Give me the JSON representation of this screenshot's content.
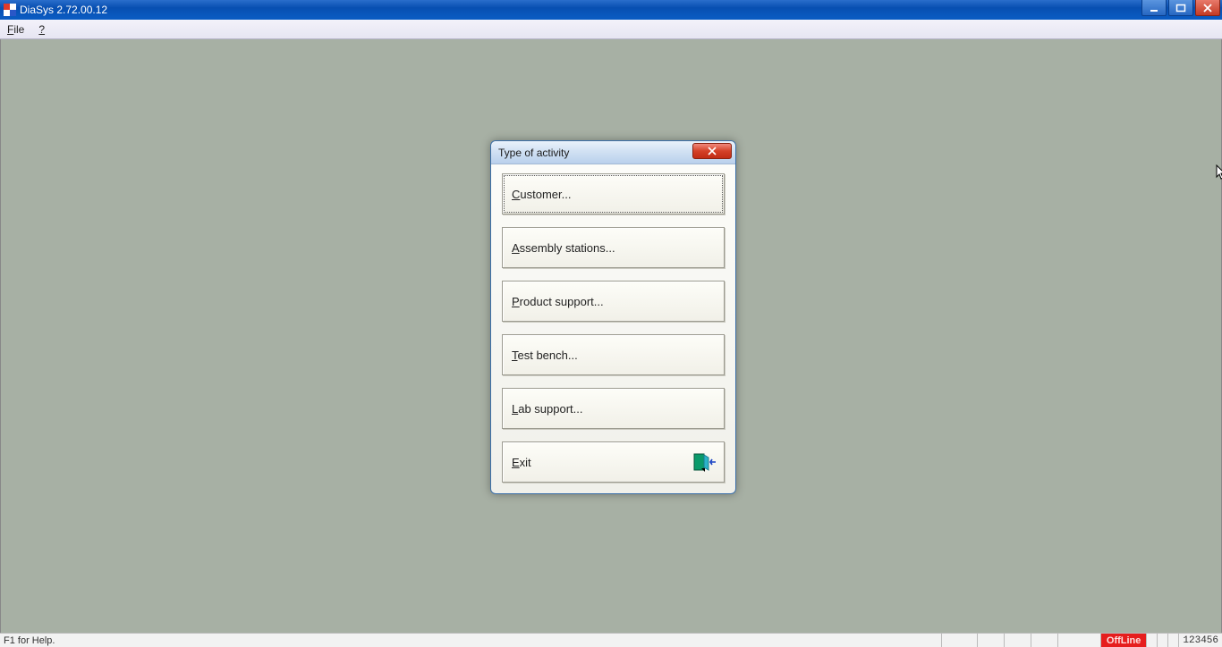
{
  "app": {
    "title": "DiaSys 2.72.00.12"
  },
  "menubar": {
    "file": {
      "hotkey": "F",
      "rest": "ile"
    },
    "help": {
      "glyph": "?"
    }
  },
  "dialog": {
    "title": "Type of activity",
    "buttons": {
      "customer": {
        "hotkey": "C",
        "rest": "ustomer..."
      },
      "assembly_stations": {
        "hotkey": "A",
        "rest": "ssembly stations..."
      },
      "product_support": {
        "hotkey": "P",
        "rest": "roduct support..."
      },
      "test_bench": {
        "hotkey": "T",
        "rest": "est bench..."
      },
      "lab_support": {
        "hotkey": "L",
        "rest": "ab support..."
      },
      "exit": {
        "hotkey": "E",
        "rest": "xit"
      }
    }
  },
  "statusbar": {
    "help_hint": "F1 for Help.",
    "offline_label": "OffLine",
    "indicators": [
      "",
      "",
      ""
    ],
    "number": "123456"
  }
}
